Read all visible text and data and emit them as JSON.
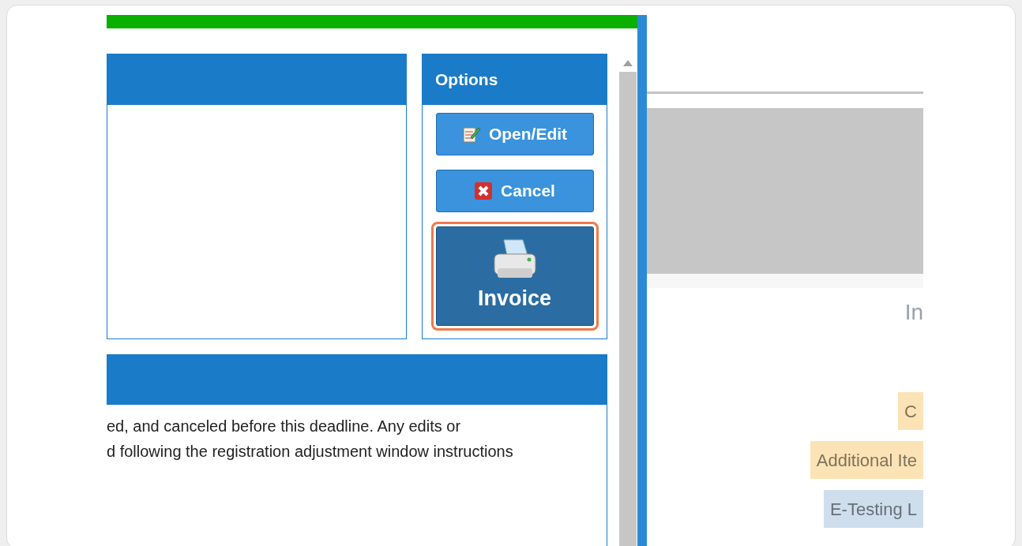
{
  "options": {
    "title": "Options",
    "buttons": [
      {
        "label": "Open/Edit",
        "kind": "edit",
        "highlighted": false
      },
      {
        "label": "Cancel",
        "kind": "cancel",
        "highlighted": false
      },
      {
        "label": "Invoice",
        "kind": "invoice",
        "highlighted": true
      }
    ]
  },
  "notice": {
    "lines": [
      "ed, and canceled before this deadline. Any edits or",
      "d following the registration adjustment window instructions"
    ]
  },
  "background_page": {
    "heading": "In",
    "tags": [
      {
        "label": "C",
        "color": "#fce3b5"
      },
      {
        "label": "Additional Ite",
        "color": "#fce3b5"
      },
      {
        "label": "E-Testing L",
        "color": "#cfdeec"
      }
    ]
  }
}
